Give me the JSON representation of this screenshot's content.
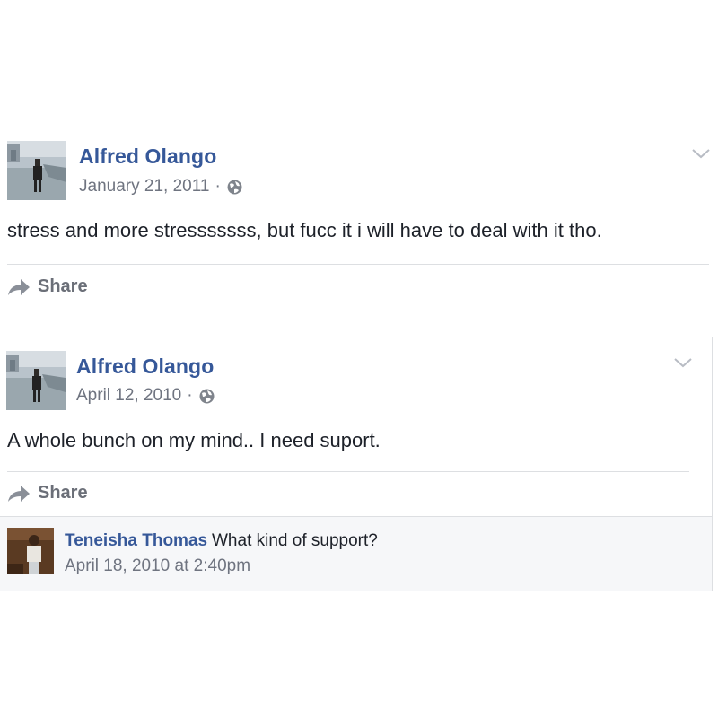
{
  "posts": [
    {
      "author": "Alfred Olango",
      "date": "January 21, 2011",
      "separator": "·",
      "text": "stress and more stresssssss, but fucc it i will have to deal with it tho.",
      "share_label": "Share"
    },
    {
      "author": "Alfred Olango",
      "date": "April 12, 2010",
      "separator": "·",
      "text": "A whole bunch on my mind.. I need suport.",
      "share_label": "Share",
      "comment": {
        "author": "Teneisha Thomas",
        "text": "What kind of support?",
        "time": "April 18, 2010 at 2:40pm"
      }
    }
  ],
  "colors": {
    "link": "#365899",
    "meta": "#6f7480",
    "text": "#1d2129",
    "divider": "#dddfe2",
    "comment_bg": "#f6f7f9"
  },
  "icons": {
    "privacy": "globe-icon",
    "menu": "chevron-down-icon",
    "share": "share-arrow-icon"
  }
}
